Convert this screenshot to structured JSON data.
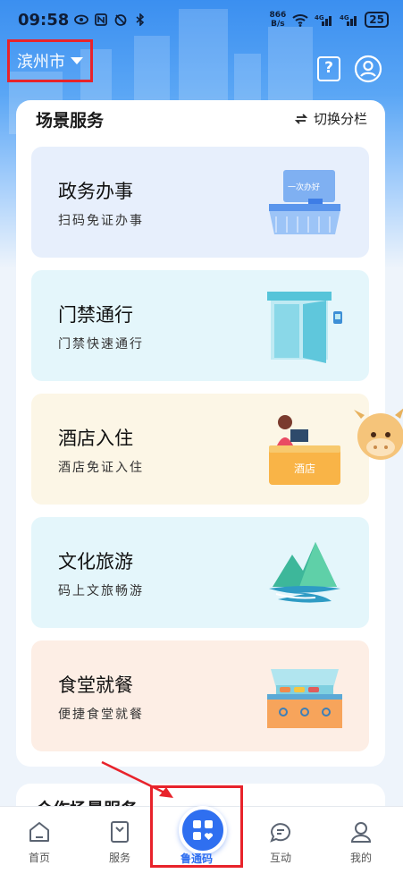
{
  "status_bar": {
    "time": "09:58",
    "net_speed_value": "866",
    "net_speed_unit": "B/s",
    "battery": "25"
  },
  "header": {
    "city": "滨州市"
  },
  "scene_services": {
    "title": "场景服务",
    "switch_label": "切换分栏",
    "items": [
      {
        "title": "政务办事",
        "subtitle": "扫码免证办事",
        "bg": "#e7effc",
        "illus_text": "一次办好"
      },
      {
        "title": "门禁通行",
        "subtitle": "门禁快速通行",
        "bg": "#e4f6fb"
      },
      {
        "title": "酒店入住",
        "subtitle": "酒店免证入住",
        "bg": "#fcf6e6",
        "illus_text": "酒店"
      },
      {
        "title": "文化旅游",
        "subtitle": "码上文旅畅游",
        "bg": "#e4f6fb"
      },
      {
        "title": "食堂就餐",
        "subtitle": "便捷食堂就餐",
        "bg": "#fdeee5"
      }
    ]
  },
  "partner_section": {
    "title": "合作场景服务"
  },
  "tab_bar": {
    "items": [
      {
        "label": "首页"
      },
      {
        "label": "服务"
      },
      {
        "label": "鲁通码"
      },
      {
        "label": "互动"
      },
      {
        "label": "我的"
      }
    ]
  },
  "colors": {
    "accent": "#2f6ff0",
    "highlight_border": "#e8232b"
  }
}
